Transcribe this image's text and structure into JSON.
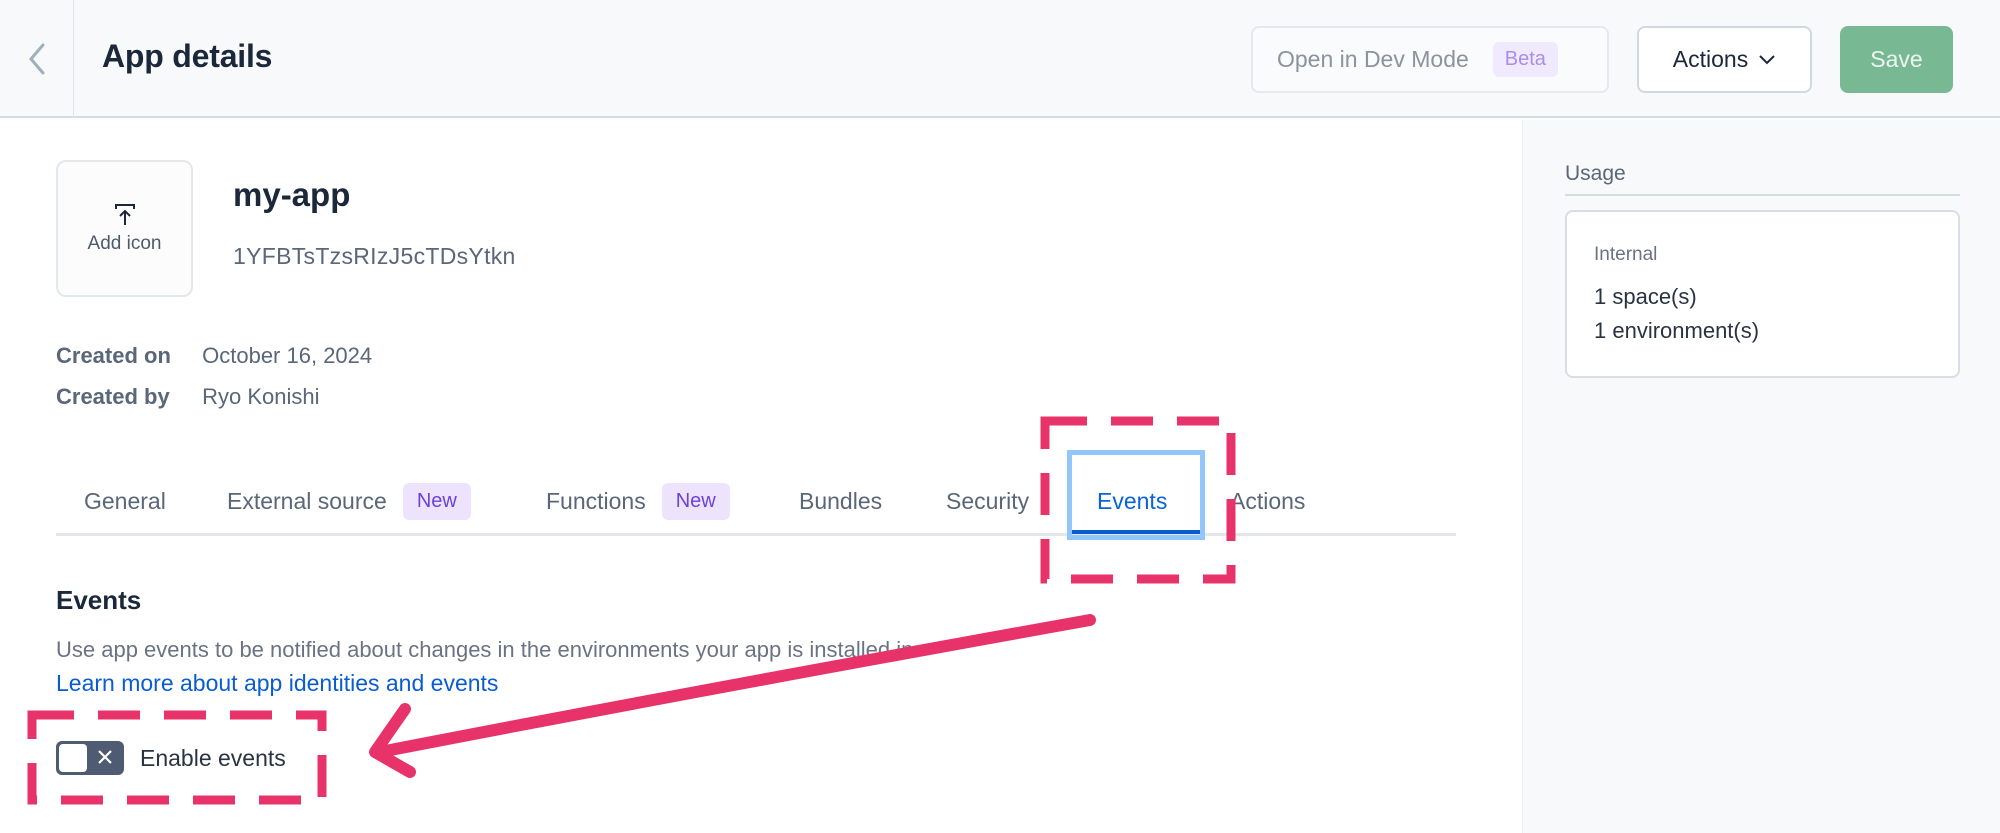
{
  "header": {
    "title": "App details",
    "back_icon": "chevron-left-icon",
    "dev_mode_label": "Open in Dev Mode",
    "dev_mode_badge": "Beta",
    "actions_label": "Actions",
    "save_label": "Save"
  },
  "app": {
    "icon_label": "Add icon",
    "name": "my-app",
    "id": "1YFBTsTzsRIzJ5cTDsYtkn",
    "created_on_label": "Created on",
    "created_on": "October 16, 2024",
    "created_by_label": "Created by",
    "created_by": "Ryo Konishi"
  },
  "tabs": [
    {
      "label": "General",
      "badge": null
    },
    {
      "label": "External source",
      "badge": "New"
    },
    {
      "label": "Functions",
      "badge": "New"
    },
    {
      "label": "Bundles",
      "badge": null
    },
    {
      "label": "Security",
      "badge": null
    },
    {
      "label": "Events",
      "badge": null,
      "active": true
    },
    {
      "label": "Actions",
      "badge": null
    }
  ],
  "events": {
    "title": "Events",
    "description": "Use app events to be notified about changes in the environments your app is installed in.",
    "link": "Learn more about app identities and events",
    "toggle_label": "Enable events",
    "toggle_on": false
  },
  "usage": {
    "title": "Usage",
    "card_label": "Internal",
    "spaces": "1 space(s)",
    "environments": "1 environment(s)"
  },
  "colors": {
    "accent": "#0a5cd1",
    "save": "#78b994",
    "badge_bg": "#ede3fd",
    "badge_fg": "#6c43d6",
    "annotation": "#e8336a"
  }
}
